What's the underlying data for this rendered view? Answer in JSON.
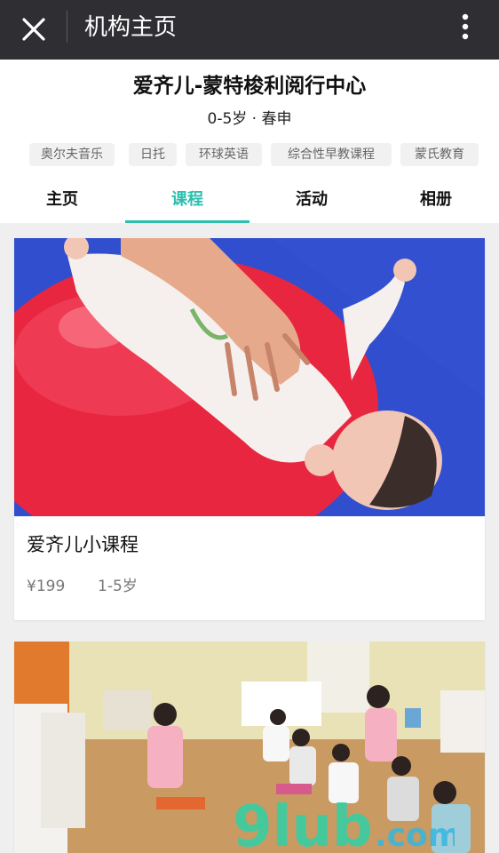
{
  "topbar": {
    "title": "机构主页",
    "close_icon": "close-icon",
    "more_icon": "more-vertical-icon"
  },
  "header": {
    "org_name": "爱齐儿-蒙特梭利阅行中心",
    "subtitle": "0-5岁 · 春申",
    "tags": [
      "奥尔夫音乐",
      "日托",
      "环球英语",
      "综合性早教课程",
      "蒙氏教育"
    ]
  },
  "tabs": [
    {
      "label": "主页",
      "active": false
    },
    {
      "label": "课程",
      "active": true
    },
    {
      "label": "活动",
      "active": false
    },
    {
      "label": "相册",
      "active": false
    }
  ],
  "courses": [
    {
      "title": "爱齐儿小课程",
      "price": "¥199",
      "age": "1-5岁",
      "image": "baby-on-exercise-ball-photo"
    },
    {
      "image": "classroom-children-photo"
    }
  ],
  "watermark": "9lub.com",
  "colors": {
    "topbar_bg": "#2e2e33",
    "accent": "#2bbfae",
    "page_bg": "#efefef"
  }
}
